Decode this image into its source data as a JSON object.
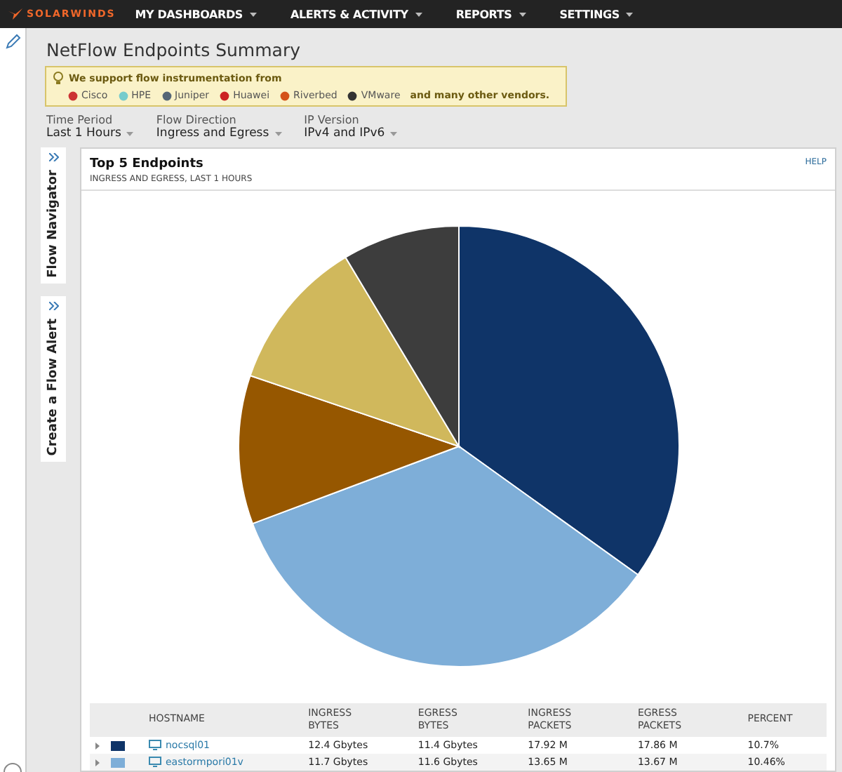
{
  "top_nav": {
    "logo": "SOLARWINDS",
    "menus": [
      {
        "label": "MY DASHBOARDS"
      },
      {
        "label": "ALERTS & ACTIVITY"
      },
      {
        "label": "REPORTS"
      },
      {
        "label": "SETTINGS"
      }
    ]
  },
  "page_title": "NetFlow Endpoints Summary",
  "vendor_banner": {
    "heading": "We support flow instrumentation from",
    "vendors": [
      "Cisco",
      "HPE",
      "Juniper",
      "Huawei",
      "Riverbed",
      "VMware"
    ],
    "trailer": "and many other vendors."
  },
  "filters": [
    {
      "label": "Time Period",
      "value": "Last 1 Hours"
    },
    {
      "label": "Flow Direction",
      "value": "Ingress and Egress"
    },
    {
      "label": "IP Version",
      "value": "IPv4 and IPv6"
    }
  ],
  "side_tabs": [
    {
      "label": "Flow Navigator"
    },
    {
      "label": "Create a Flow Alert"
    }
  ],
  "widget": {
    "title": "Top 5 Endpoints",
    "subtitle": "INGRESS AND EGRESS, LAST 1 HOURS",
    "help": "HELP",
    "table": {
      "columns": [
        "HOSTNAME",
        "INGRESS BYTES",
        "EGRESS BYTES",
        "INGRESS PACKETS",
        "EGRESS PACKETS",
        "PERCENT"
      ],
      "rows": [
        {
          "color": "#0f3468",
          "cells": [
            "nocsql01",
            "12.4 Gbytes",
            "11.4 Gbytes",
            "17.92 M",
            "17.86 M",
            "10.7%"
          ]
        },
        {
          "color": "#7eaed8",
          "cells": [
            "eastormpori01v",
            "11.7 Gbytes",
            "11.6 Gbytes",
            "13.65 M",
            "13.67 M",
            "10.46%"
          ]
        }
      ]
    }
  }
}
